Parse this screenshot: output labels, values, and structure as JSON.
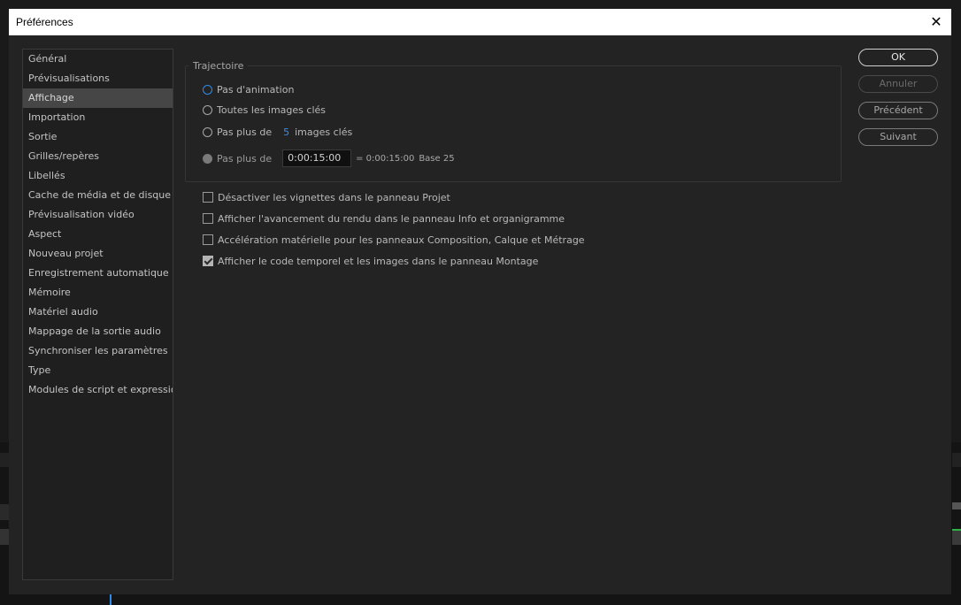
{
  "window": {
    "title": "Préférences"
  },
  "sidebar": {
    "items": [
      {
        "label": "Général"
      },
      {
        "label": "Prévisualisations"
      },
      {
        "label": "Affichage"
      },
      {
        "label": "Importation"
      },
      {
        "label": "Sortie"
      },
      {
        "label": "Grilles/repères"
      },
      {
        "label": "Libellés"
      },
      {
        "label": "Cache de média et de disque"
      },
      {
        "label": "Prévisualisation vidéo"
      },
      {
        "label": "Aspect"
      },
      {
        "label": "Nouveau projet"
      },
      {
        "label": "Enregistrement automatique"
      },
      {
        "label": "Mémoire"
      },
      {
        "label": "Matériel audio"
      },
      {
        "label": "Mappage de la sortie audio"
      },
      {
        "label": "Synchroniser les paramètres"
      },
      {
        "label": "Type"
      },
      {
        "label": "Modules de script et expressions"
      }
    ],
    "selected": "Affichage"
  },
  "trajectoire": {
    "title": "Trajectoire",
    "options": [
      {
        "label": "Pas d'animation"
      },
      {
        "label": "Toutes les images clés"
      },
      {
        "label": "Pas plus de",
        "value": "5",
        "suffix": "images clés"
      },
      {
        "label": "Pas plus de",
        "time": "0:00:15:00",
        "equals": "= 0:00:15:00",
        "base": "Base 25"
      }
    ],
    "selected": "Pas d'animation"
  },
  "checkboxes": [
    {
      "label": "Désactiver les vignettes dans le panneau Projet",
      "checked": false
    },
    {
      "label": "Afficher l'avancement du rendu dans le panneau Info et organigramme",
      "checked": false
    },
    {
      "label": "Accélération matérielle pour les panneaux Composition, Calque et Métrage",
      "checked": false
    },
    {
      "label": "Afficher le code temporel et les images dans le panneau Montage",
      "checked": true
    }
  ],
  "buttons": {
    "ok": "OK",
    "cancel": "Annuler",
    "previous": "Précédent",
    "next": "Suivant"
  },
  "colors": {
    "accent": "#2e8bea",
    "selection": "#464646"
  }
}
